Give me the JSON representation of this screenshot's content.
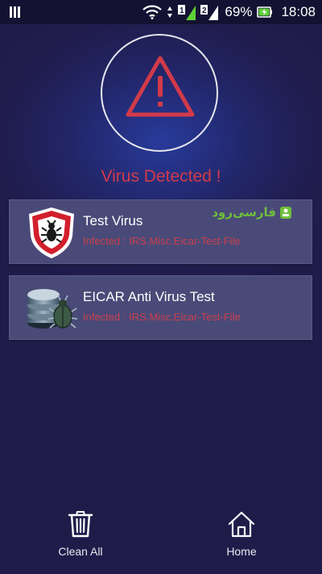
{
  "status_bar": {
    "sim1_label": "1",
    "sim2_label": "2",
    "battery_percent": "69%",
    "time": "18:08",
    "icons": [
      "notification-icon",
      "wifi-icon",
      "signal-sim1-icon",
      "signal-sim2-icon",
      "battery-charging-icon"
    ]
  },
  "alert": {
    "icon": "warning-triangle-icon",
    "title": "Virus Detected !",
    "title_color": "#d23a4a"
  },
  "threats": [
    {
      "name": "Test Virus",
      "status": "Infected : IRS.Misc.Eicar-Test-File",
      "icon": "shield-bug-icon"
    },
    {
      "name": "EICAR Anti Virus Test",
      "status": "Infected : IRS.Misc.Eicar-Test-File",
      "icon": "database-bug-icon"
    }
  ],
  "watermark": {
    "text": "فارسی‌رود"
  },
  "bottom_bar": {
    "clean_all_label": "Clean All",
    "clean_all_icon": "trash-icon",
    "home_label": "Home",
    "home_icon": "home-icon"
  },
  "colors": {
    "background": "#201d4e",
    "card_background": "#4a4a78",
    "status_red": "#c8404c"
  }
}
